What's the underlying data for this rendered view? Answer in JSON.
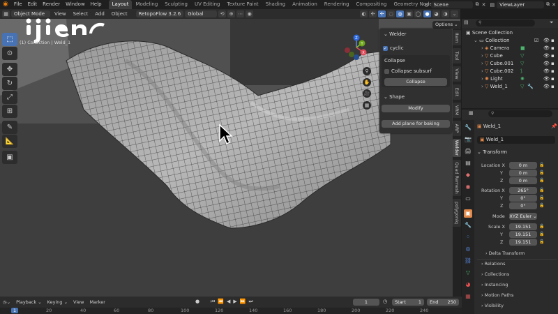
{
  "topbar": {
    "menu": [
      "File",
      "Edit",
      "Render",
      "Window",
      "Help"
    ],
    "workspaces": [
      "Layout",
      "Modeling",
      "Sculpting",
      "UV Editing",
      "Texture Paint",
      "Shading",
      "Animation",
      "Rendering",
      "Compositing",
      "Geometry Nodes"
    ],
    "active_workspace": "Layout",
    "scene": "Scene",
    "view_layer": "ViewLayer"
  },
  "viewport_header": {
    "mode": "Object Mode",
    "menus": [
      "View",
      "Select",
      "Add",
      "Object"
    ],
    "addon": "RetopoFlow 3.2.6",
    "orientation": "Global",
    "options": "Options"
  },
  "viewport_overlay": {
    "line1": "(1) Collection | Weld_1"
  },
  "watermark": "ijien",
  "npanel": {
    "welder_title": "Welder",
    "cyclic_label": "cyclic",
    "cyclic_checked": true,
    "collapse_title": "Collapse",
    "collapse_subsurf_label": "Collapse subsurf",
    "collapse_button": "Collapse",
    "shape_title": "Shape",
    "modify_button": "Modify",
    "add_plane_button": "Add plane for baking",
    "tabs": [
      "Item",
      "Tool",
      "View",
      "Edit",
      "VRM",
      "ARP",
      "Welder",
      "Quad Remesh",
      "polygoniq"
    ],
    "active_tab": "Welder"
  },
  "outliner": {
    "scene_collection": "Scene Collection",
    "items": [
      {
        "name": "Collection",
        "icon": "collection-icon",
        "color": "#dddddd"
      },
      {
        "name": "Camera",
        "icon": "camera-icon",
        "color": "#e0884a"
      },
      {
        "name": "Cube",
        "icon": "object-icon",
        "color": "#e0884a"
      },
      {
        "name": "Cube.001",
        "icon": "object-icon",
        "color": "#e0884a"
      },
      {
        "name": "Cube.002",
        "icon": "object-icon",
        "color": "#e0884a"
      },
      {
        "name": "Light",
        "icon": "light-icon",
        "color": "#e0884a"
      },
      {
        "name": "Weld_1",
        "icon": "object-icon",
        "color": "#e0884a"
      }
    ]
  },
  "properties": {
    "object_name": "Weld_1",
    "data_name": "Weld_1",
    "transform_title": "Transform",
    "location_label": "Location X",
    "location": [
      "0 m",
      "0 m",
      "0 m"
    ],
    "rotation_label": "Rotation X",
    "rotation": [
      "265°",
      "0°",
      "0°"
    ],
    "mode_label": "Mode",
    "mode_value": "XYZ Euler",
    "scale_label": "Scale X",
    "scale": [
      "19.151",
      "19.151",
      "19.151"
    ],
    "axis_y": "Y",
    "axis_z": "Z",
    "delta_transform": "Delta Transform",
    "sections": [
      "Relations",
      "Collections",
      "Instancing",
      "Motion Paths",
      "Visibility"
    ]
  },
  "timeline": {
    "menus": [
      "Playback",
      "Keying",
      "View",
      "Marker"
    ],
    "current_frame": "1",
    "start_label": "Start",
    "start": "1",
    "end_label": "End",
    "end": "250",
    "ruler": [
      "1",
      "20",
      "40",
      "60",
      "80",
      "100",
      "120",
      "140",
      "160",
      "180",
      "200",
      "220",
      "240"
    ]
  },
  "colors": {
    "accent": "#4772b3",
    "object_orange": "#e0884a"
  }
}
